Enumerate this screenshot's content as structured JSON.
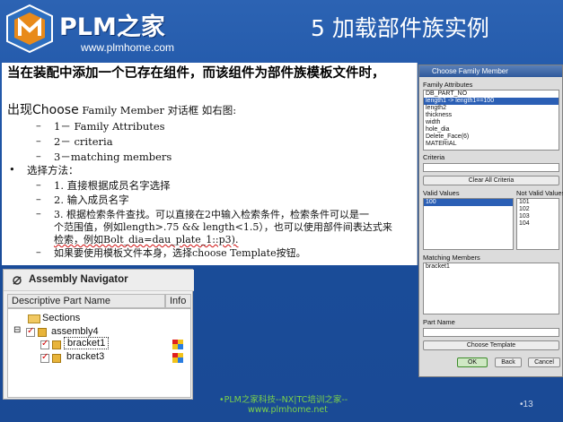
{
  "header": {
    "logo_text": "PLM之家",
    "logo_url": "www.plmhome.com",
    "slide_title": "5  加载部件族实例"
  },
  "text_panel": {
    "heading": "当在装配中添加一个已存在组件，而该组件为部件族模板文件时，",
    "intro_prefix": "出现Choose",
    "intro_rest": " Family Member 对话框 如右图:",
    "items": [
      "1－ Family Attributes",
      "2－ criteria",
      "3－matching  members"
    ],
    "method_label": "选择方法：",
    "methods": [
      "1. 直接根据成员名字选择",
      "2. 输入成员名字",
      "3. 根据检索条件查找。可以直接在2中输入检索条件，检索条件可以是一",
      "个范围值，例如length>.75  && length<1.5），也可以使用部件间表达式来",
      "检索，例如Bolt_dia=dau_plate_1::p3).",
      "如果要使用模板文件本身，选择choose   Template按钮。"
    ],
    "bullet_dash": "–",
    "bullet_dot": "•"
  },
  "navigator": {
    "title": "Assembly Navigator",
    "columns": [
      "Descriptive Part Name",
      "Info"
    ],
    "rows": [
      {
        "label": "Sections"
      },
      {
        "label": "assembly4"
      },
      {
        "label": "bracket1"
      },
      {
        "label": "bracket3"
      }
    ],
    "expander": "⊟"
  },
  "dialog": {
    "title": "Choose Family Member",
    "family_attributes_label": "Family Attributes",
    "attributes": [
      "DB_PART_NO",
      "length1 -> length1==100",
      "length2",
      "thickness",
      "width",
      "hole_dia",
      "Delete_Face(6)",
      "MATERIAL"
    ],
    "selected_attribute_index": 1,
    "criteria_label": "Criteria",
    "clear_button": "Clear All Criteria",
    "valid_label": "Valid Values",
    "not_valid_label": "Not Valid Values",
    "valid_values": [
      "100"
    ],
    "not_valid_values": [
      "101",
      "102",
      "103",
      "104"
    ],
    "matching_label": "Matching Members",
    "matching_members": [
      "bracket1"
    ],
    "part_name_label": "Part Name",
    "choose_template_button": "Choose Template",
    "ok_button": "OK",
    "back_button": "Back",
    "cancel_button": "Cancel"
  },
  "footer": {
    "line1": "•PLM之家科技--NX|TC培训之家--",
    "line2": "www.plmhome.net",
    "page_number": "•13"
  },
  "colors": {
    "background": "#1f55a6",
    "footer_green": "#7cd24a",
    "selection": "#2b5fb5"
  }
}
